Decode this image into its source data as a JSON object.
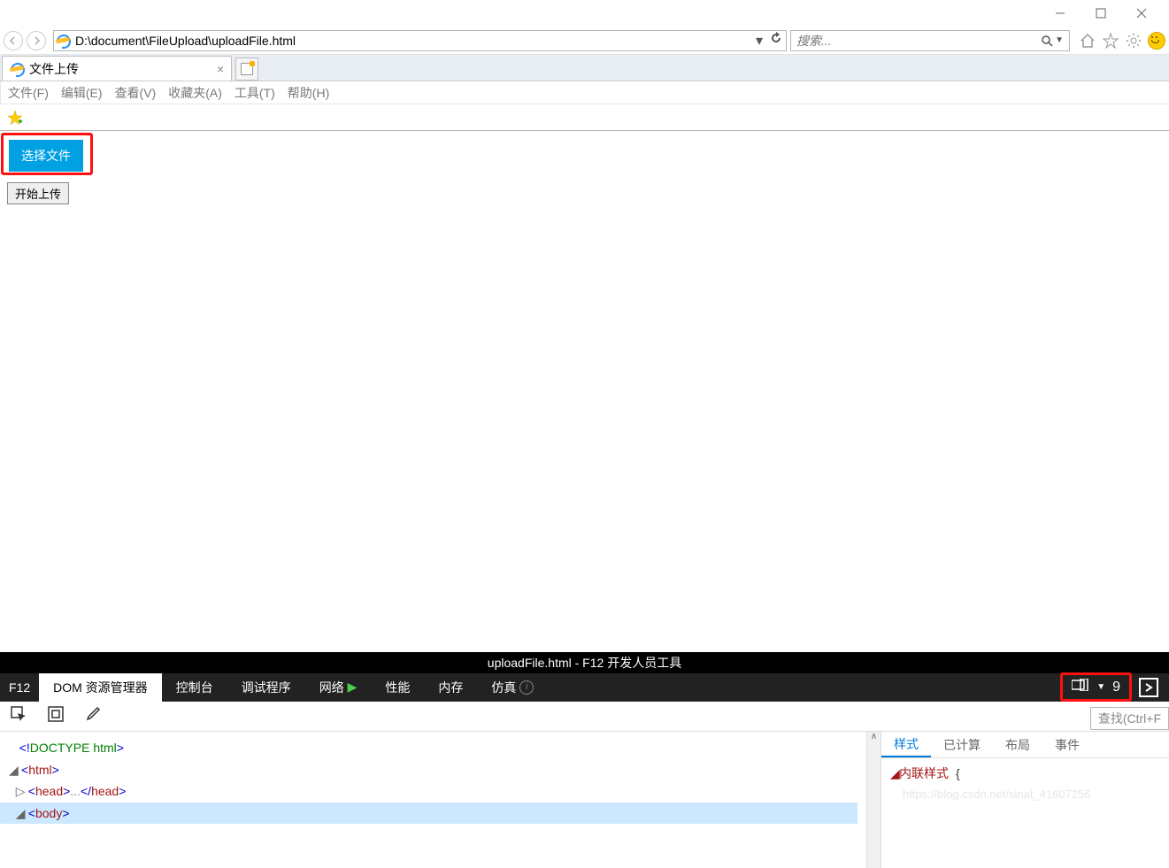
{
  "window": {
    "title": "文件上传"
  },
  "address_bar": {
    "url": "D:\\document\\FileUpload\\uploadFile.html"
  },
  "search": {
    "placeholder": "搜索..."
  },
  "tab": {
    "title": "文件上传"
  },
  "menu": {
    "file": "文件(F)",
    "edit": "编辑(E)",
    "view": "查看(V)",
    "favorites": "收藏夹(A)",
    "tools": "工具(T)",
    "help": "帮助(H)"
  },
  "page": {
    "select_file_btn": "选择文件",
    "upload_btn": "开始上传"
  },
  "devtools": {
    "title": "uploadFile.html - F12 开发人员工具",
    "f12": "F12",
    "tabs": {
      "dom": "DOM 资源管理器",
      "console": "控制台",
      "debugger": "调试程序",
      "network": "网络",
      "performance": "性能",
      "memory": "内存",
      "emulation": "仿真"
    },
    "error_count": "9",
    "find_placeholder": "查找(Ctrl+F",
    "dom": {
      "doctype_bang": "<!",
      "doctype_kw": "DOCTYPE html",
      "doctype_close": ">",
      "html_open": "<html>",
      "head_open": "<head>",
      "head_ellipsis": "...",
      "head_close": "</head>",
      "body_open": "<body>"
    },
    "styles": {
      "tab_styles": "样式",
      "tab_computed": "已计算",
      "tab_layout": "布局",
      "tab_events": "事件",
      "inline": "内联样式",
      "brace": "{",
      "watermark": "https://blog.csdn.net/sinat_41607256"
    }
  }
}
